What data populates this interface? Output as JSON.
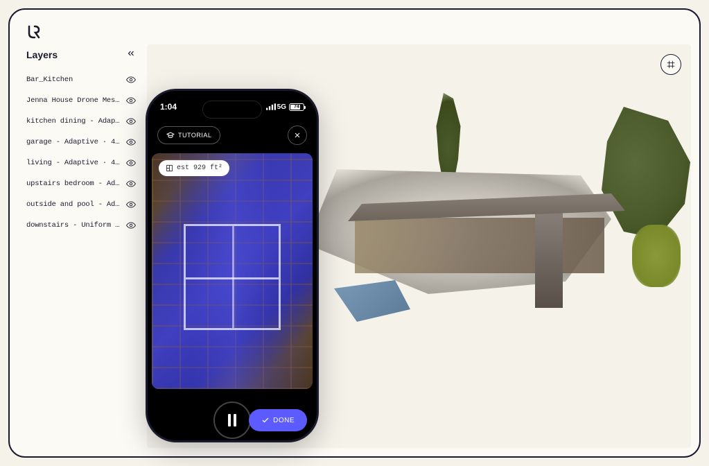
{
  "sidebar": {
    "title": "Layers",
    "items": [
      {
        "label": "Bar_Kitchen",
        "visible": true
      },
      {
        "label": "Jenna House Drone Mesh …",
        "visible": true
      },
      {
        "label": "kitchen dining - Adapti…",
        "visible": true
      },
      {
        "label": "garage - Adaptive · 40%…",
        "visible": true
      },
      {
        "label": "living - Adaptive · 40%…",
        "visible": true
      },
      {
        "label": "upstairs bedroom - Adap…",
        "visible": true
      },
      {
        "label": "outside and pool - Adap…",
        "visible": true
      },
      {
        "label": "downstairs - Uniform · …",
        "visible": true
      }
    ]
  },
  "phone": {
    "time": "1:04",
    "network": "5G",
    "battery_pct": "74",
    "tutorial_label": "TUTORIAL",
    "estimate": "est 929 ft²",
    "done_label": "DONE"
  }
}
